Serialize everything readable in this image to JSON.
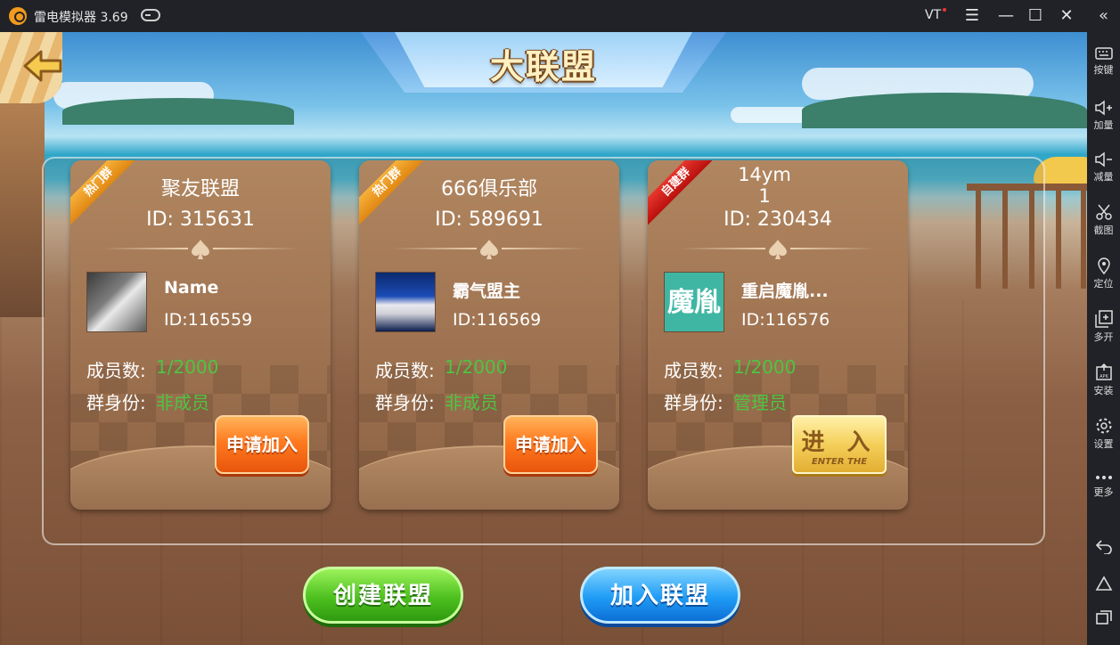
{
  "titlebar": {
    "app_title": "雷电模拟器 3.69",
    "vt_label": "VT",
    "menu_glyph": "☰",
    "minimize_glyph": "—",
    "maximize_glyph": "☐",
    "close_glyph": "✕"
  },
  "sidebar": {
    "collapse_glyph": "«",
    "items": [
      {
        "label": "按键",
        "icon": "keyboard-icon"
      },
      {
        "label": "加量",
        "icon": "volume-up-icon"
      },
      {
        "label": "减量",
        "icon": "volume-down-icon"
      },
      {
        "label": "截图",
        "icon": "scissors-icon"
      },
      {
        "label": "定位",
        "icon": "location-icon"
      },
      {
        "label": "多开",
        "icon": "multi-open-icon"
      },
      {
        "label": "安装",
        "icon": "apk-install-icon"
      },
      {
        "label": "设置",
        "icon": "gear-icon"
      },
      {
        "label": "更多",
        "icon": "more-icon"
      }
    ],
    "nav": [
      "back-icon",
      "home-icon",
      "recent-apps-icon"
    ]
  },
  "game": {
    "page_title": "大联盟",
    "cards": [
      {
        "tag": "热门群",
        "tag_type": "hot",
        "group_name": "聚友联盟",
        "group_id": "ID: 315631",
        "owner_name": "Name",
        "owner_id": "ID:116559",
        "avatar_type": "photo",
        "member_label": "成员数:",
        "member_value": "1/2000",
        "role_label": "群身份:",
        "role_value": "非成员",
        "action": "申请加入"
      },
      {
        "tag": "热门群",
        "tag_type": "hot",
        "group_name": "666俱乐部",
        "group_id": "ID: 589691",
        "owner_name": "霸气盟主",
        "owner_id": "ID:116569",
        "avatar_type": "photo",
        "member_label": "成员数:",
        "member_value": "1/2000",
        "role_label": "群身份:",
        "role_value": "非成员",
        "action": "申请加入"
      },
      {
        "tag": "自建群",
        "tag_type": "self",
        "group_name": "14ym1",
        "group_id": "ID: 230434",
        "owner_name": "重启魔胤...",
        "owner_id": "ID:116576",
        "avatar_type": "text",
        "avatar_text": "魔胤",
        "member_label": "成员数:",
        "member_value": "1/2000",
        "role_label": "群身份:",
        "role_value": "管理员",
        "action_cn": "进 入",
        "action_en": "ENTER THE"
      }
    ],
    "create_button": "创建联盟",
    "join_button": "加入联盟"
  },
  "colors": {
    "green_text": "#4ec443",
    "hot_ribbon": "#e08712",
    "self_ribbon": "#b9100d",
    "apply_button": "#ff7a1f",
    "enter_button": "#f4cf5a",
    "create_button": "#4dc01f",
    "join_button": "#1f9cf5"
  }
}
